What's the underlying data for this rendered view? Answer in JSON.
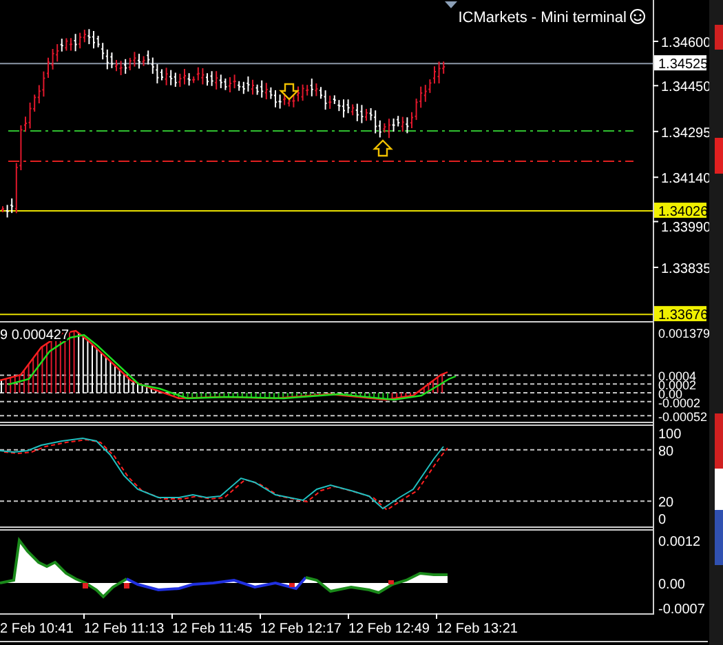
{
  "title": "ICMarkets - Mini terminal",
  "price_axis": [
    {
      "label": "1.34600",
      "kind": "tick"
    },
    {
      "label": "1.34525",
      "kind": "current"
    },
    {
      "label": "1.34450",
      "kind": "tick"
    },
    {
      "label": "1.34295",
      "kind": "tick"
    },
    {
      "label": "1.34140",
      "kind": "tick"
    },
    {
      "label": "1.34026",
      "kind": "level"
    },
    {
      "label": "1.33990",
      "kind": "tick"
    },
    {
      "label": "1.33835",
      "kind": "tick"
    },
    {
      "label": "1.33676",
      "kind": "level"
    }
  ],
  "macd": {
    "legend": "9 0.000427",
    "axis": [
      "0.001379",
      "0.0004",
      "0.0002",
      "0.00",
      "-0.0002",
      "-0.00052"
    ]
  },
  "stochastic": {
    "axis": [
      "100",
      "80",
      "20",
      "0"
    ]
  },
  "oscillator": {
    "axis": [
      "0.0012",
      "0.00",
      "-0.0007"
    ]
  },
  "time_axis": [
    "2 Feb 10:41",
    "12 Feb 11:13",
    "12 Feb 11:45",
    "12 Feb 12:17",
    "12 Feb 12:49",
    "12 Feb 13:21"
  ]
}
